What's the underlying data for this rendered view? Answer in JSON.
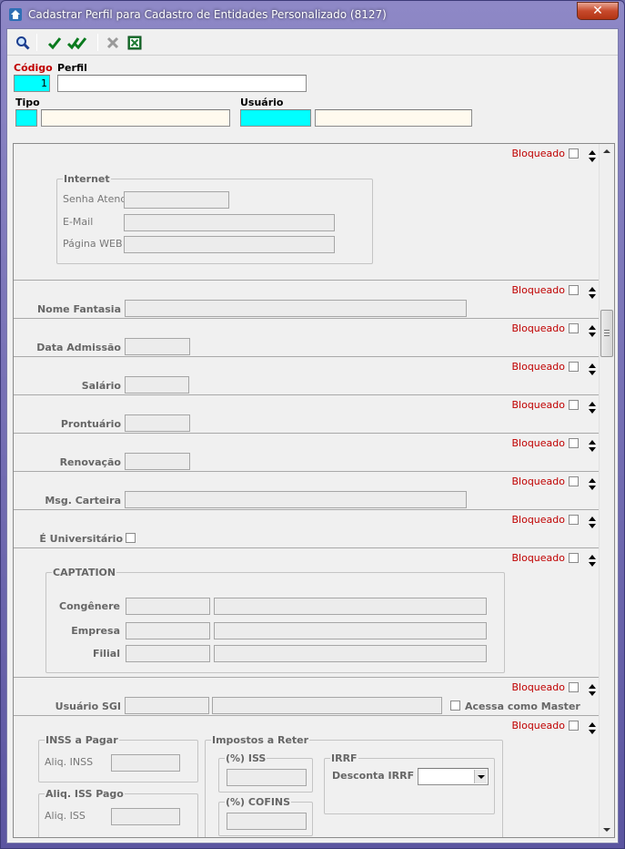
{
  "window": {
    "title": "Cadastrar Perfil para Cadastro de Entidades Personalizado (8127)",
    "close_label": "✕"
  },
  "toolbar": {
    "icons": [
      "search-icon",
      "confirm-icon",
      "confirm-all-icon",
      "cancel-icon",
      "excel-icon"
    ]
  },
  "header": {
    "codigo_label": "Código",
    "codigo_value": "1",
    "perfil_label": "Perfil",
    "perfil_value": "",
    "tipo_label": "Tipo",
    "usuario_label": "Usuário"
  },
  "blocked_label": "Bloqueado",
  "sections": {
    "internet": {
      "title": "Internet",
      "senha_label": "Senha Atend.",
      "email_label": "E-Mail",
      "web_label": "Página WEB"
    },
    "nome_fantasia": {
      "label": "Nome Fantasia"
    },
    "data_admissao": {
      "label": "Data Admissão"
    },
    "salario": {
      "label": "Salário"
    },
    "prontuario": {
      "label": "Prontuário"
    },
    "renovacao": {
      "label": "Renovação"
    },
    "msg_carteira": {
      "label": "Msg. Carteira"
    },
    "universitario": {
      "label": "É Universitário"
    },
    "captation": {
      "title": "CAPTATION",
      "congenere_label": "Congênere",
      "empresa_label": "Empresa",
      "filial_label": "Filial"
    },
    "usuario_sgi": {
      "label": "Usuário SGI",
      "master_label": "Acessa como Master"
    },
    "impostos": {
      "inss_title": "INSS a Pagar",
      "aliq_inss_label": "Aliq. INSS",
      "iss_pago_title": "Aliq. ISS Pago",
      "aliq_iss_label": "Aliq. ISS",
      "reter_title": "Impostos a Reter",
      "iss_title": "(%) ISS",
      "cofins_title": "(%) COFINS",
      "irrf_title": "IRRF",
      "desconta_irrf_label": "Desconta IRRF"
    }
  },
  "colors": {
    "required_label": "#c00000",
    "key_field": "#00ffff",
    "lookup_field": "#fffaee"
  }
}
